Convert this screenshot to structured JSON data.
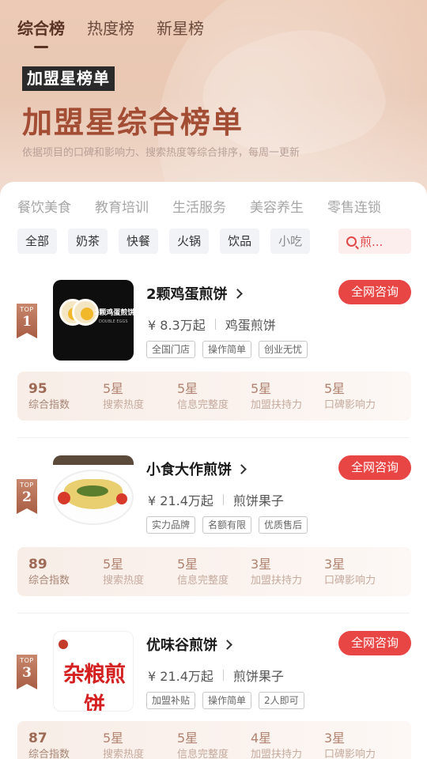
{
  "top_tabs": [
    "综合榜",
    "热度榜",
    "新星榜"
  ],
  "hero": {
    "badge": "加盟星榜单",
    "title": "加盟星综合榜单",
    "subtitle": "依据项目的口碑和影响力、搜索热度等综合排序，每周一更新"
  },
  "categories": [
    "餐饮美食",
    "教育培训",
    "生活服务",
    "美容养生",
    "零售连锁"
  ],
  "chips": [
    "全部",
    "奶茶",
    "快餐",
    "火锅",
    "饮品",
    "小吃"
  ],
  "search": {
    "text": "煎..."
  },
  "consult_label": "全网咨询",
  "rank_prefix": "TOP",
  "items": [
    {
      "rank": "1",
      "name": "2颗鸡蛋煎饼",
      "price": "¥ 8.3万起",
      "category": "鸡蛋煎饼",
      "tags": [
        "全国门店",
        "操作简单",
        "创业无忧"
      ],
      "thumb_text": "2颗鸡蛋煎饼",
      "thumb_sub": "DOUBLE EGGS",
      "score": "95",
      "score_label": "综合指数",
      "stats": [
        {
          "value": "5星",
          "label": "搜索热度"
        },
        {
          "value": "5星",
          "label": "信息完整度"
        },
        {
          "value": "5星",
          "label": "加盟扶持力"
        },
        {
          "value": "5星",
          "label": "口碑影响力"
        }
      ]
    },
    {
      "rank": "2",
      "name": "小食大作煎饼",
      "price": "¥ 21.4万起",
      "category": "煎饼果子",
      "tags": [
        "实力品牌",
        "名额有限",
        "优质售后"
      ],
      "score": "89",
      "score_label": "综合指数",
      "stats": [
        {
          "value": "5星",
          "label": "搜索热度"
        },
        {
          "value": "5星",
          "label": "信息完整度"
        },
        {
          "value": "3星",
          "label": "加盟扶持力"
        },
        {
          "value": "3星",
          "label": "口碑影响力"
        }
      ]
    },
    {
      "rank": "3",
      "name": "优味谷煎饼",
      "price": "¥ 21.4万起",
      "category": "煎饼果子",
      "tags": [
        "加盟补贴",
        "操作简单",
        "2人即可"
      ],
      "thumb_text": "杂粮煎饼",
      "score": "87",
      "score_label": "综合指数",
      "stats": [
        {
          "value": "5星",
          "label": "搜索热度"
        },
        {
          "value": "5星",
          "label": "信息完整度"
        },
        {
          "value": "4星",
          "label": "加盟扶持力"
        },
        {
          "value": "3星",
          "label": "口碑影响力"
        }
      ]
    }
  ]
}
